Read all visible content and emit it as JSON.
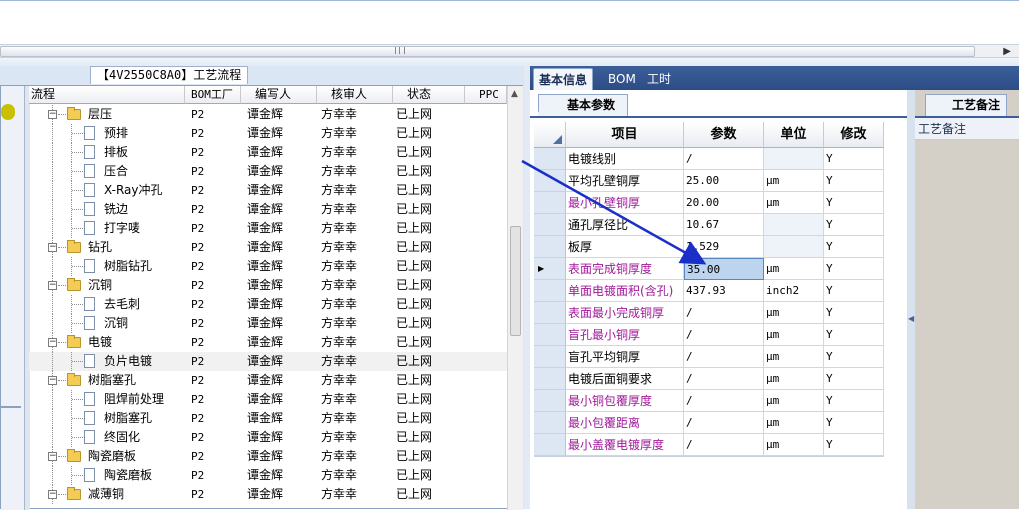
{
  "left_panel": {
    "title": "【4V2550C8A0】工艺流程",
    "columns": [
      "流程",
      "BOM工厂",
      "编写人",
      "核审人",
      "状态",
      "PPC"
    ],
    "rows": [
      {
        "level": 0,
        "type": "folder",
        "name": "层压",
        "bom": "P2",
        "author": "谭金辉",
        "reviewer": "方幸幸",
        "status": "已上网"
      },
      {
        "level": 1,
        "type": "doc",
        "name": "预排",
        "bom": "P2",
        "author": "谭金辉",
        "reviewer": "方幸幸",
        "status": "已上网"
      },
      {
        "level": 1,
        "type": "doc",
        "name": "排板",
        "bom": "P2",
        "author": "谭金辉",
        "reviewer": "方幸幸",
        "status": "已上网"
      },
      {
        "level": 1,
        "type": "doc",
        "name": "压合",
        "bom": "P2",
        "author": "谭金辉",
        "reviewer": "方幸幸",
        "status": "已上网"
      },
      {
        "level": 1,
        "type": "doc",
        "name": "X-Ray冲孔",
        "bom": "P2",
        "author": "谭金辉",
        "reviewer": "方幸幸",
        "status": "已上网"
      },
      {
        "level": 1,
        "type": "doc",
        "name": "铣边",
        "bom": "P2",
        "author": "谭金辉",
        "reviewer": "方幸幸",
        "status": "已上网"
      },
      {
        "level": 1,
        "type": "doc",
        "name": "打字唛",
        "bom": "P2",
        "author": "谭金辉",
        "reviewer": "方幸幸",
        "status": "已上网"
      },
      {
        "level": 0,
        "type": "folder",
        "name": "钻孔",
        "bom": "P2",
        "author": "谭金辉",
        "reviewer": "方幸幸",
        "status": "已上网"
      },
      {
        "level": 1,
        "type": "doc",
        "name": "树脂钻孔",
        "bom": "P2",
        "author": "谭金辉",
        "reviewer": "方幸幸",
        "status": "已上网"
      },
      {
        "level": 0,
        "type": "folder",
        "name": "沉铜",
        "bom": "P2",
        "author": "谭金辉",
        "reviewer": "方幸幸",
        "status": "已上网"
      },
      {
        "level": 1,
        "type": "doc",
        "name": "去毛刺",
        "bom": "P2",
        "author": "谭金辉",
        "reviewer": "方幸幸",
        "status": "已上网"
      },
      {
        "level": 1,
        "type": "doc",
        "name": "沉铜",
        "bom": "P2",
        "author": "谭金辉",
        "reviewer": "方幸幸",
        "status": "已上网"
      },
      {
        "level": 0,
        "type": "folder",
        "name": "电镀",
        "bom": "P2",
        "author": "谭金辉",
        "reviewer": "方幸幸",
        "status": "已上网"
      },
      {
        "level": 1,
        "type": "doc",
        "name": "负片电镀",
        "bom": "P2",
        "author": "谭金辉",
        "reviewer": "方幸幸",
        "status": "已上网",
        "selected": true
      },
      {
        "level": 0,
        "type": "folder",
        "name": "树脂塞孔",
        "bom": "P2",
        "author": "谭金辉",
        "reviewer": "方幸幸",
        "status": "已上网"
      },
      {
        "level": 1,
        "type": "doc",
        "name": "阻焊前处理",
        "bom": "P2",
        "author": "谭金辉",
        "reviewer": "方幸幸",
        "status": "已上网"
      },
      {
        "level": 1,
        "type": "doc",
        "name": "树脂塞孔",
        "bom": "P2",
        "author": "谭金辉",
        "reviewer": "方幸幸",
        "status": "已上网"
      },
      {
        "level": 1,
        "type": "doc",
        "name": "终固化",
        "bom": "P2",
        "author": "谭金辉",
        "reviewer": "方幸幸",
        "status": "已上网"
      },
      {
        "level": 0,
        "type": "folder",
        "name": "陶瓷磨板",
        "bom": "P2",
        "author": "谭金辉",
        "reviewer": "方幸幸",
        "status": "已上网"
      },
      {
        "level": 1,
        "type": "doc",
        "name": "陶瓷磨板",
        "bom": "P2",
        "author": "谭金辉",
        "reviewer": "方幸幸",
        "status": "已上网"
      },
      {
        "level": 0,
        "type": "folder",
        "name": "减薄铜",
        "bom": "P2",
        "author": "谭金辉",
        "reviewer": "方幸幸",
        "status": "已上网"
      }
    ]
  },
  "right_tabs": [
    "基本信息",
    "BOM",
    "工时"
  ],
  "basic_params": {
    "tab_label": "基本参数",
    "columns": [
      "项目",
      "参数",
      "单位",
      "修改"
    ],
    "rows": [
      {
        "name": "电镀线别",
        "value": "/",
        "unit": "",
        "modify": "Y",
        "purple": false
      },
      {
        "name": "平均孔壁铜厚",
        "value": "25.00",
        "unit": "μm",
        "modify": "Y",
        "purple": false
      },
      {
        "name": "最小孔壁铜厚",
        "value": "20.00",
        "unit": "μm",
        "modify": "Y",
        "purple": true
      },
      {
        "name": "通孔厚径比",
        "value": "10.67",
        "unit": "",
        "modify": "Y",
        "purple": false
      },
      {
        "name": "板厚",
        "value": "1.529",
        "unit": "",
        "modify": "Y",
        "purple": false
      },
      {
        "name": "表面完成铜厚度",
        "value": "35.00",
        "unit": "μm",
        "modify": "Y",
        "purple": true,
        "current": true
      },
      {
        "name": "单面电镀面积(含孔)",
        "value": "437.93",
        "unit": "inch2",
        "modify": "Y",
        "purple": true
      },
      {
        "name": "表面最小完成铜厚",
        "value": "/",
        "unit": "μm",
        "modify": "Y",
        "purple": true
      },
      {
        "name": "盲孔最小铜厚",
        "value": "/",
        "unit": "μm",
        "modify": "Y",
        "purple": true
      },
      {
        "name": "盲孔平均铜厚",
        "value": "/",
        "unit": "μm",
        "modify": "Y",
        "purple": false
      },
      {
        "name": "电镀后面铜要求",
        "value": "/",
        "unit": "μm",
        "modify": "Y",
        "purple": false
      },
      {
        "name": "最小铜包覆厚度",
        "value": "/",
        "unit": "μm",
        "modify": "Y",
        "purple": true
      },
      {
        "name": "最小包覆距离",
        "value": "/",
        "unit": "μm",
        "modify": "Y",
        "purple": true
      },
      {
        "name": "最小盖覆电镀厚度",
        "value": "/",
        "unit": "μm",
        "modify": "Y",
        "purple": true
      }
    ]
  },
  "notes": {
    "tab_label": "工艺备注",
    "field_label": "工艺备注"
  },
  "colors": {
    "purple_text": "#a0199a",
    "tab_bar": "#2f5088",
    "arrow": "#1a2fc8"
  }
}
